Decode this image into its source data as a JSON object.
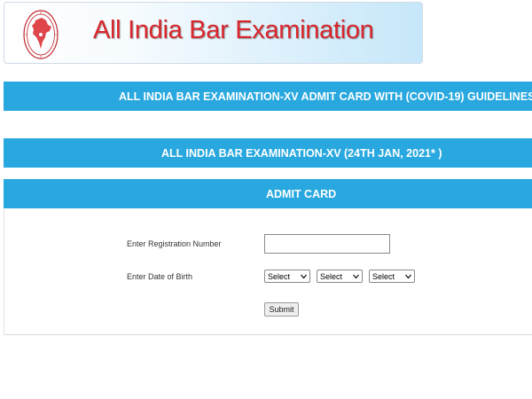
{
  "header": {
    "title": "All India Bar Examination",
    "logo_icon": "bci-emblem-icon",
    "title_color": "#d8262b"
  },
  "banners": [
    "ALL INDIA BAR EXAMINATION-XV ADMIT CARD WITH (COVID-19) GUIDELINES",
    "ALL INDIA BAR EXAMINATION-XV (24TH JAN, 2021* )",
    "ADMIT CARD"
  ],
  "banner_color": "#29a8e0",
  "form": {
    "registration_label": "Enter Registration Number",
    "registration_value": "",
    "dob_label": "Enter Date of Birth",
    "day_select": "Select",
    "month_select": "Select",
    "year_select": "Select",
    "submit_label": "Submit"
  }
}
